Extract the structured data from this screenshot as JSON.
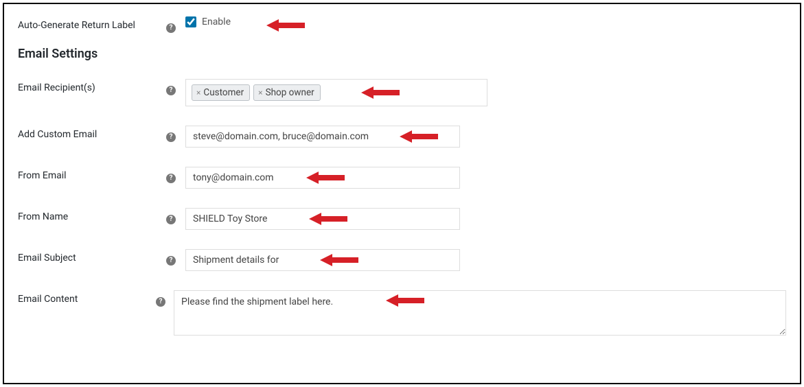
{
  "autoGenerate": {
    "label": "Auto-Generate Return Label",
    "checkboxLabel": "Enable",
    "checked": true
  },
  "sectionHeading": "Email Settings",
  "recipients": {
    "label": "Email Recipient(s)",
    "tags": [
      "Customer",
      "Shop owner"
    ]
  },
  "customEmail": {
    "label": "Add Custom Email",
    "value": "steve@domain.com, bruce@domain.com"
  },
  "fromEmail": {
    "label": "From Email",
    "value": "tony@domain.com"
  },
  "fromName": {
    "label": "From Name",
    "value": "SHIELD Toy Store"
  },
  "subject": {
    "label": "Email Subject",
    "value": "Shipment details for"
  },
  "content": {
    "label": "Email Content",
    "value": "Please find the shipment label here."
  }
}
